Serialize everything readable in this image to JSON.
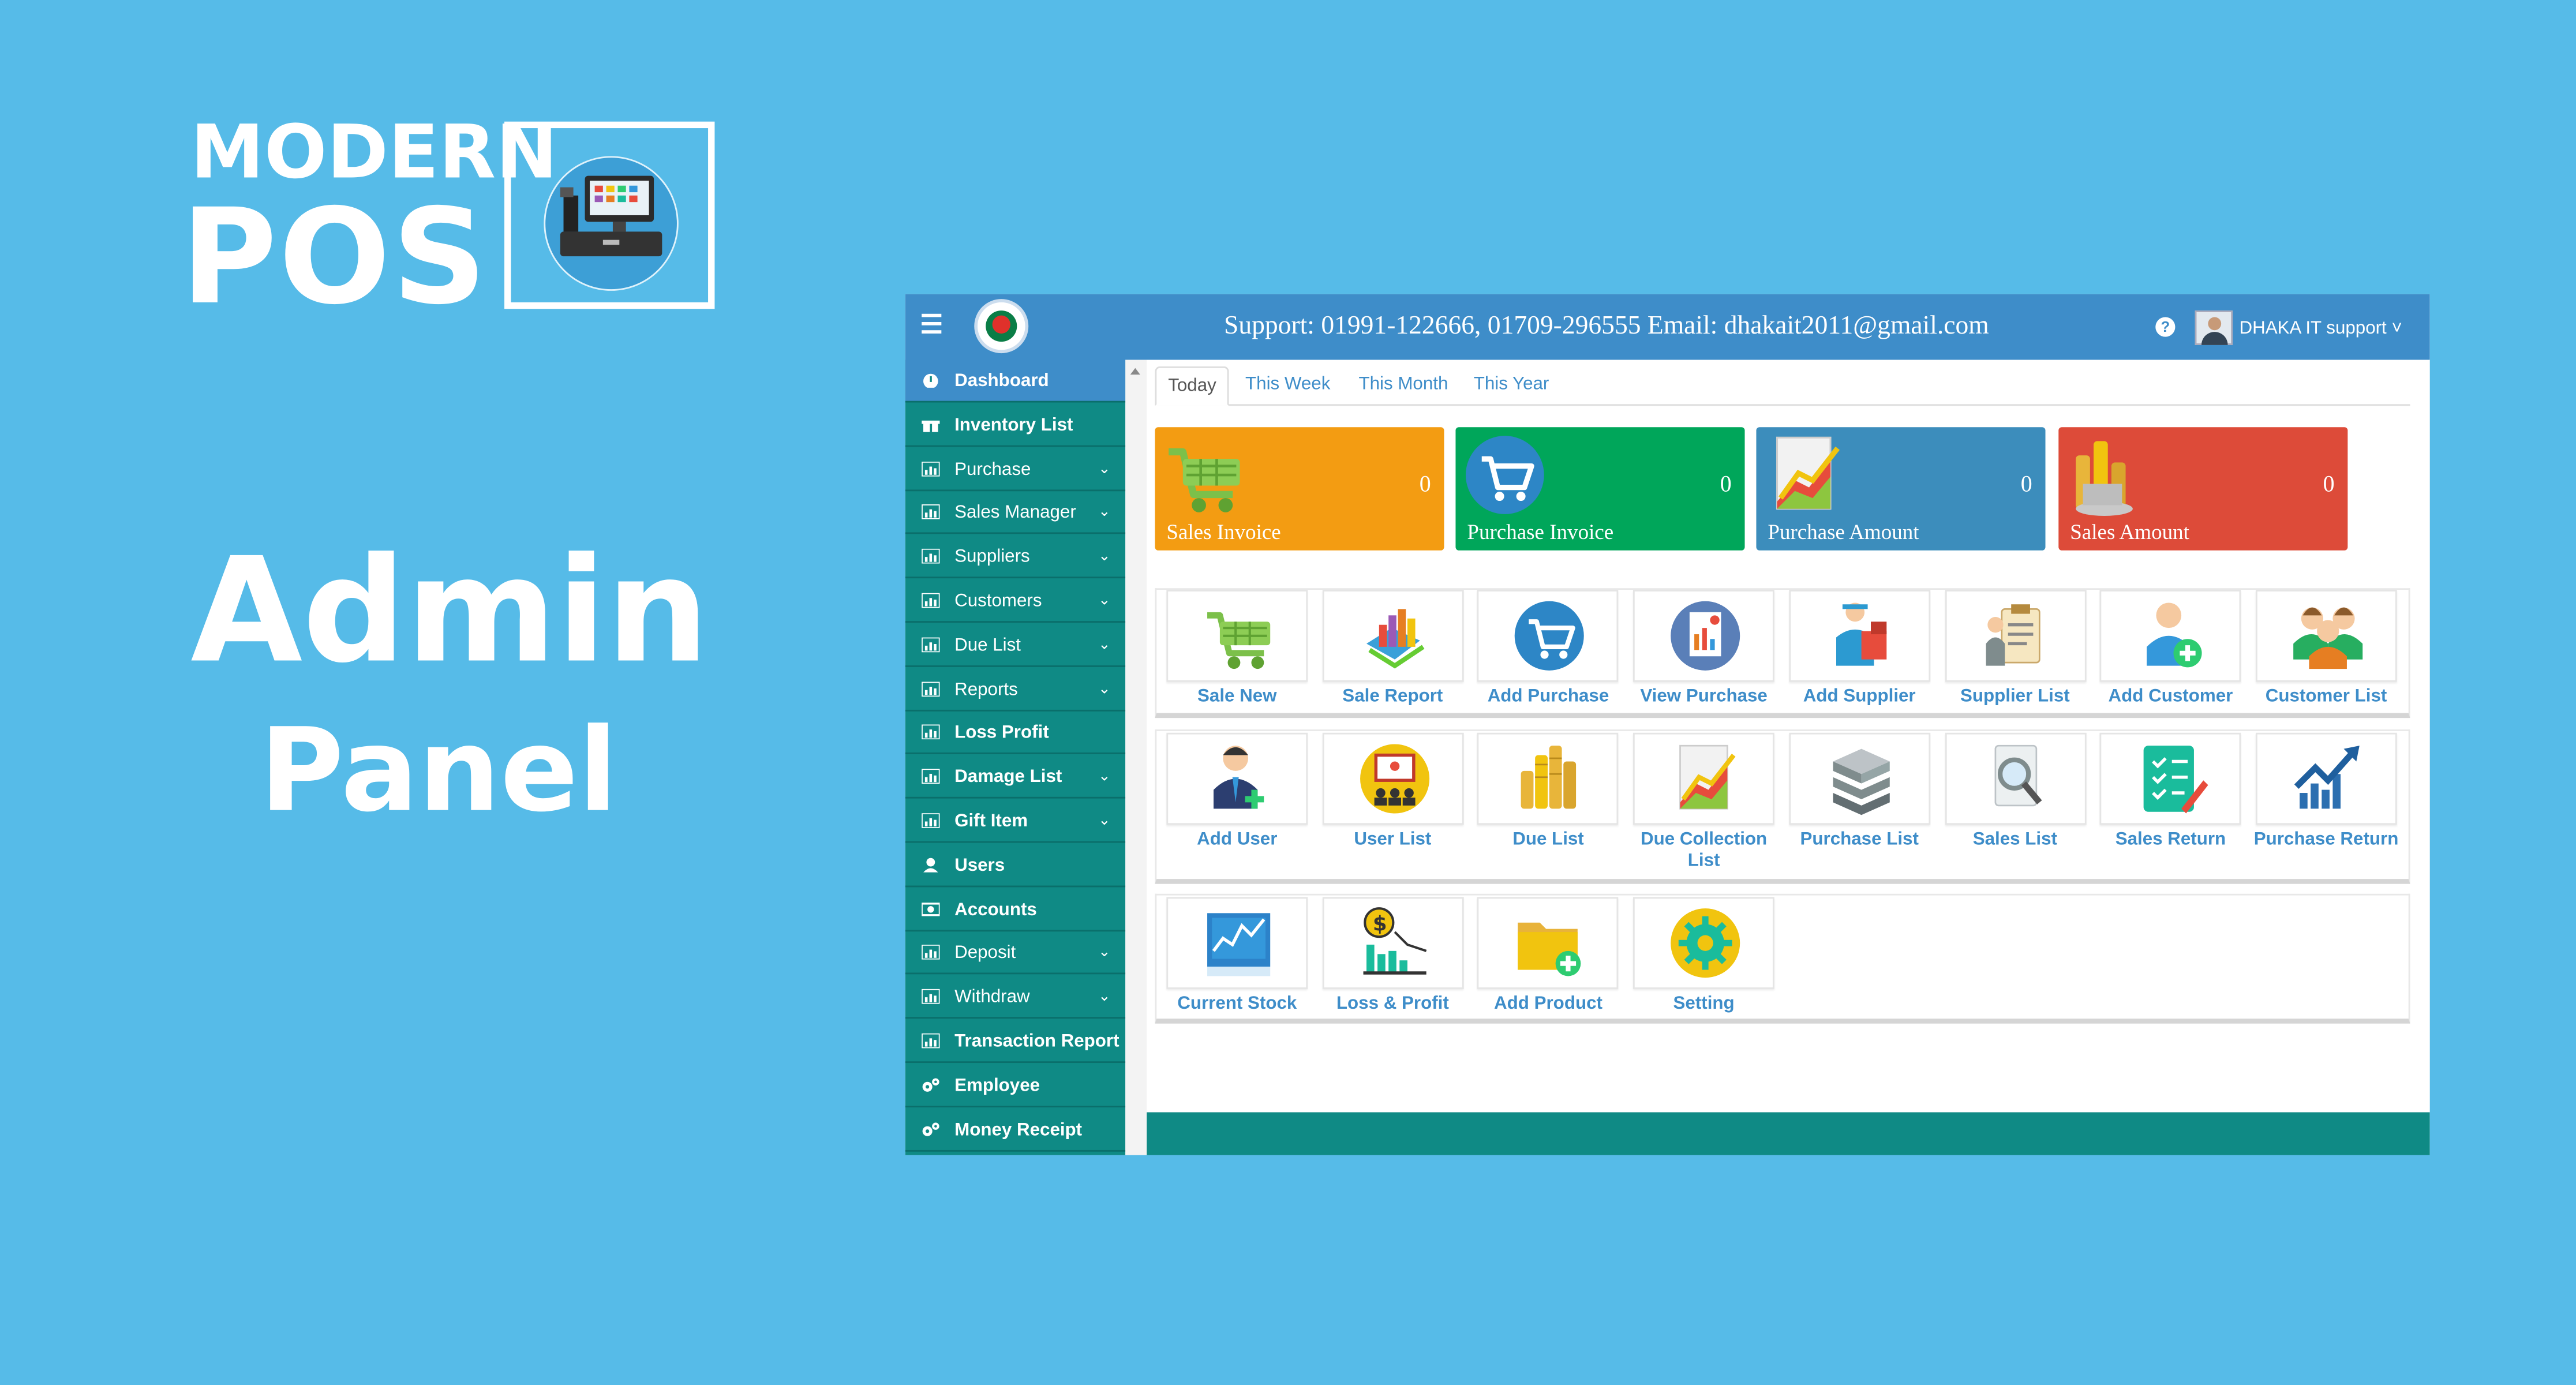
{
  "promo": {
    "brand_line1": "MODERN",
    "brand_line2": "POS",
    "title_line1": "Admin",
    "title_line2": "Panel"
  },
  "header": {
    "support_text": "Support: 01991-122666, 01709-296555 Email: dhakait2011@gmail.com",
    "help_label": "?",
    "user_name": "DHAKA IT support ˅"
  },
  "sidebar": {
    "items": [
      {
        "label": "Dashboard",
        "icon": "dashboard-icon",
        "active": true,
        "bold": true,
        "dropdown": false
      },
      {
        "label": "Inventory List",
        "icon": "gift-icon",
        "active": false,
        "bold": true,
        "dropdown": false
      },
      {
        "label": "Purchase",
        "icon": "bar-chart-icon",
        "active": false,
        "bold": false,
        "dropdown": true
      },
      {
        "label": "Sales Manager",
        "icon": "bar-chart-icon",
        "active": false,
        "bold": false,
        "dropdown": true
      },
      {
        "label": "Suppliers",
        "icon": "bar-chart-icon",
        "active": false,
        "bold": false,
        "dropdown": true
      },
      {
        "label": "Customers",
        "icon": "bar-chart-icon",
        "active": false,
        "bold": false,
        "dropdown": true
      },
      {
        "label": "Due List",
        "icon": "bar-chart-icon",
        "active": false,
        "bold": false,
        "dropdown": true
      },
      {
        "label": "Reports",
        "icon": "bar-chart-icon",
        "active": false,
        "bold": false,
        "dropdown": true
      },
      {
        "label": "Loss Profit",
        "icon": "bar-chart-icon",
        "active": false,
        "bold": true,
        "dropdown": false
      },
      {
        "label": "Damage List",
        "icon": "bar-chart-icon",
        "active": false,
        "bold": true,
        "dropdown": true
      },
      {
        "label": "Gift Item",
        "icon": "bar-chart-icon",
        "active": false,
        "bold": true,
        "dropdown": true
      },
      {
        "label": "Users",
        "icon": "user-icon",
        "active": false,
        "bold": true,
        "dropdown": false
      },
      {
        "label": "Accounts",
        "icon": "money-icon",
        "active": false,
        "bold": true,
        "dropdown": false
      },
      {
        "label": "Deposit",
        "icon": "bar-chart-icon",
        "active": false,
        "bold": false,
        "dropdown": true
      },
      {
        "label": "Withdraw",
        "icon": "bar-chart-icon",
        "active": false,
        "bold": false,
        "dropdown": true
      },
      {
        "label": "Transaction Report",
        "icon": "bar-chart-icon",
        "active": false,
        "bold": true,
        "dropdown": false
      },
      {
        "label": "Employee",
        "icon": "cogs-icon",
        "active": false,
        "bold": true,
        "dropdown": false
      },
      {
        "label": "Money Receipt",
        "icon": "cogs-icon",
        "active": false,
        "bold": true,
        "dropdown": false
      }
    ]
  },
  "tabs": [
    "Today",
    "This Week",
    "This Month",
    "This Year"
  ],
  "active_tab": "Today",
  "stats": [
    {
      "title": "Sales Invoice",
      "value": "0",
      "color": "#f39c12",
      "icon": "shopping-cart-icon"
    },
    {
      "title": "Purchase Invoice",
      "value": "0",
      "color": "#00a65a",
      "icon": "cart-circle-icon"
    },
    {
      "title": "Purchase Amount",
      "value": "0",
      "color": "#3c8dbc",
      "icon": "growth-chart-icon"
    },
    {
      "title": "Sales Amount",
      "value": "0",
      "color": "#dd4b39",
      "icon": "gold-coins-icon"
    }
  ],
  "tiles": [
    {
      "label": "Sale New",
      "icon": "shopping-cart-icon"
    },
    {
      "label": "Sale Report",
      "icon": "bar-report-icon"
    },
    {
      "label": "Add Purchase",
      "icon": "cart-circle-icon"
    },
    {
      "label": "View Purchase",
      "icon": "report-view-icon"
    },
    {
      "label": "Add Supplier",
      "icon": "delivery-man-icon"
    },
    {
      "label": "Supplier List",
      "icon": "clipboard-list-icon"
    },
    {
      "label": "Add Customer",
      "icon": "add-person-icon"
    },
    {
      "label": "Customer List",
      "icon": "people-group-icon"
    },
    {
      "label": "Add User",
      "icon": "add-user-icon"
    },
    {
      "label": "User List",
      "icon": "presentation-icon"
    },
    {
      "label": "Due List",
      "icon": "coin-stacks-icon"
    },
    {
      "label": "Due Collection List",
      "icon": "growth-chart-icon"
    },
    {
      "label": "Purchase List",
      "icon": "server-stack-icon"
    },
    {
      "label": "Sales List",
      "icon": "search-document-icon"
    },
    {
      "label": "Sales Return",
      "icon": "checklist-icon"
    },
    {
      "label": "Purchase Return",
      "icon": "trend-arrow-icon"
    },
    {
      "label": "Current Stock",
      "icon": "stock-chart-icon"
    },
    {
      "label": "Loss & Profit",
      "icon": "dollar-chart-icon"
    },
    {
      "label": "Add Product",
      "icon": "add-folder-icon"
    },
    {
      "label": "Setting",
      "icon": "gear-icon"
    }
  ]
}
